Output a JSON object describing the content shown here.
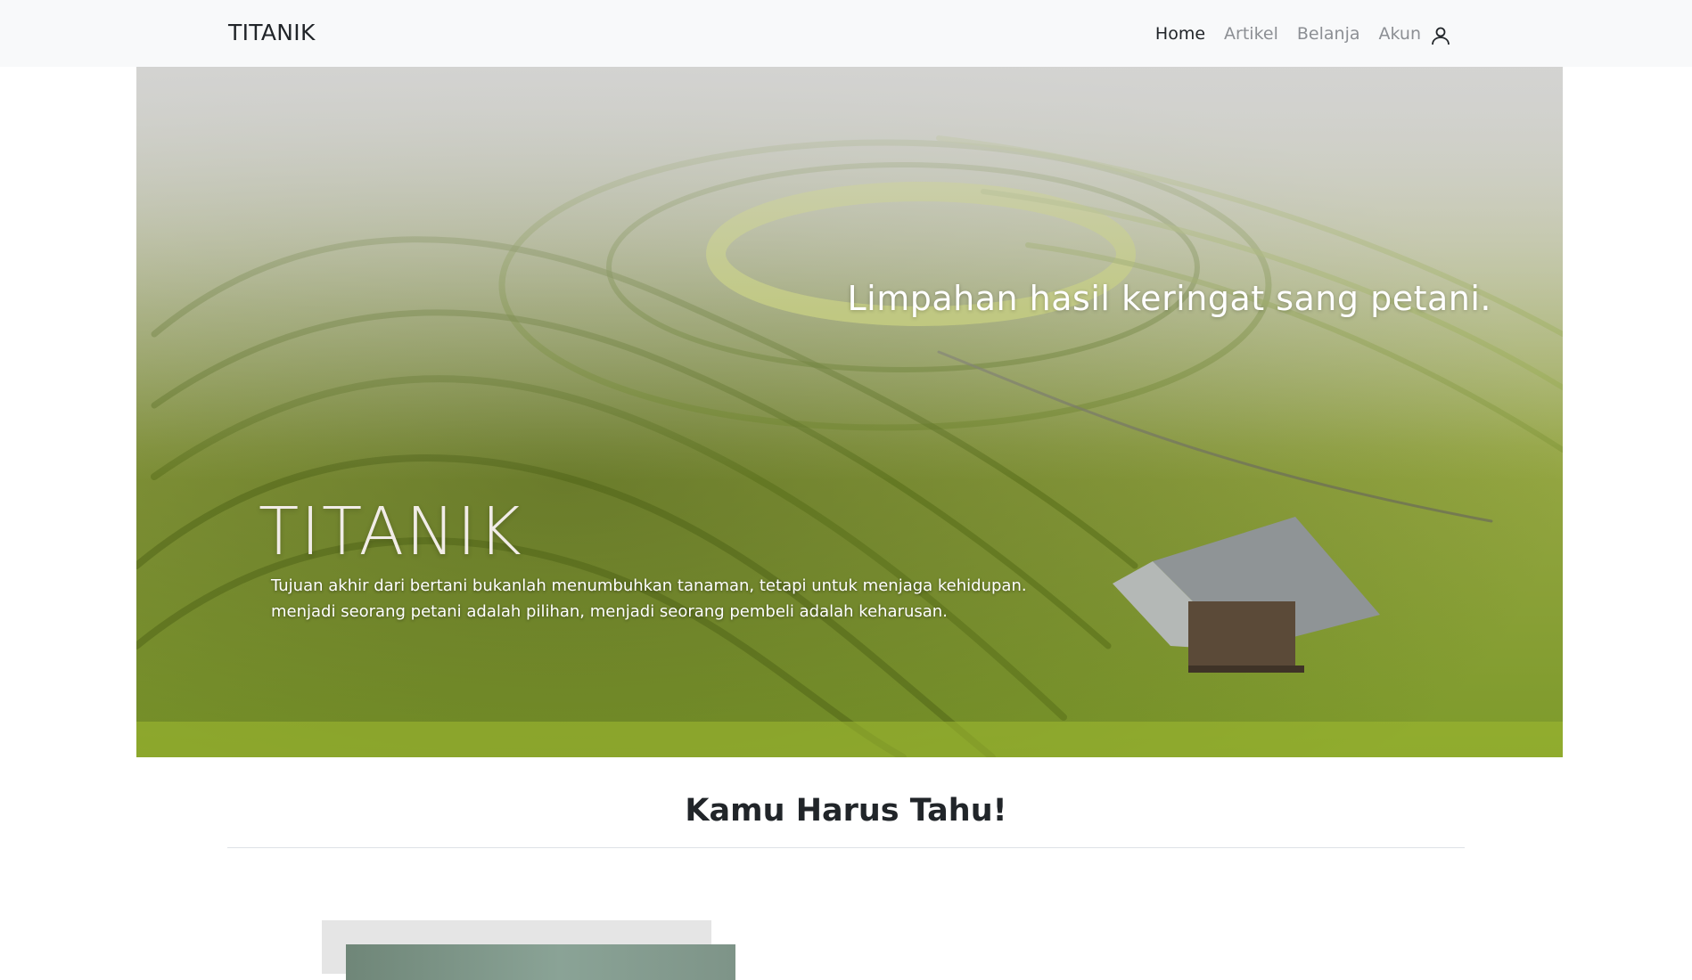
{
  "navbar": {
    "brand": "TITANIK",
    "links": [
      {
        "label": "Home",
        "active": true
      },
      {
        "label": "Artikel",
        "active": false
      },
      {
        "label": "Belanja",
        "active": false
      },
      {
        "label": "Akun",
        "active": false,
        "icon": "user-icon"
      }
    ]
  },
  "hero": {
    "tagline": "Limpahan hasil keringat sang petani.",
    "title": "TITANIK",
    "desc_line1": "Tujuan akhir dari bertani bukanlah menumbuhkan tanaman, tetapi untuk menjaga kehidupan.",
    "desc_line2": "menjadi seorang petani adalah pilihan, menjadi seorang pembeli adalah keharusan."
  },
  "section": {
    "title": "Kamu Harus Tahu!"
  },
  "colors": {
    "navbar_bg": "#f8f9fa",
    "text_dark": "#212529",
    "nav_muted": "#8c8f94",
    "hero_green": "#8ea33a"
  }
}
